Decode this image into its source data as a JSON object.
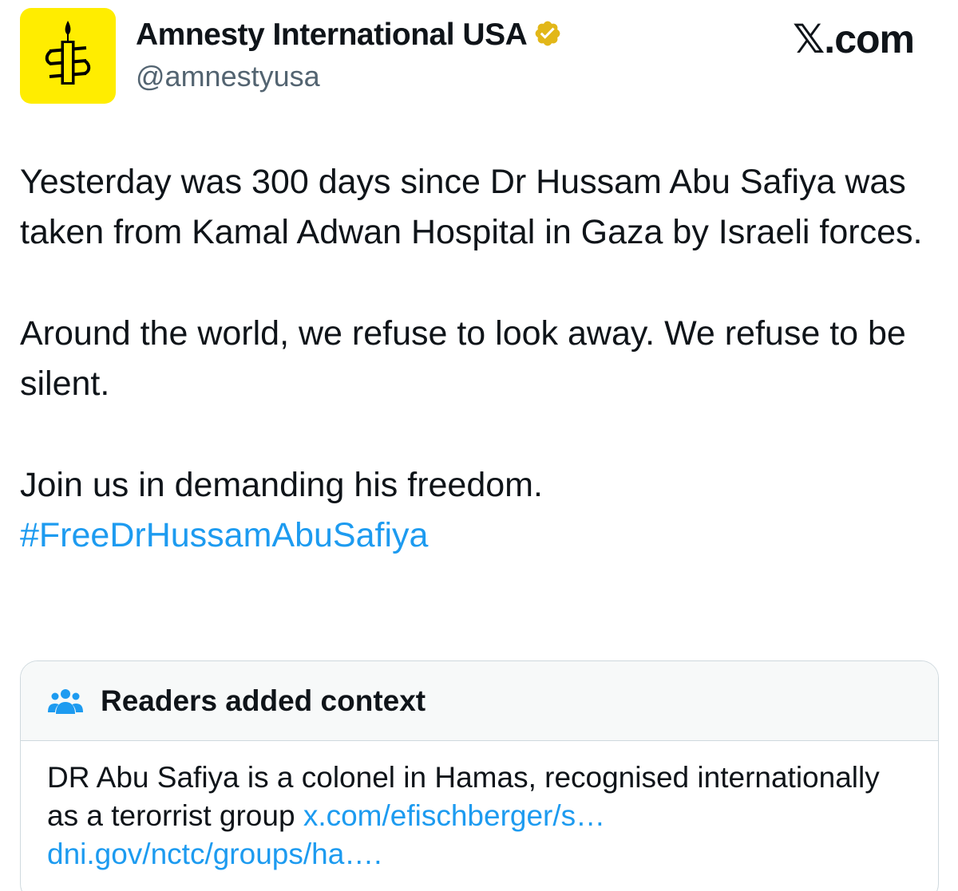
{
  "author": {
    "name": "Amnesty International USA",
    "handle": "@amnestyusa",
    "avatar_icon": "amnesty-candle-icon",
    "verified_icon": "verified-badge-icon",
    "avatar_color": "#ffed00",
    "verified_color": "#e2b719"
  },
  "brand": "𝕏.com",
  "tweet": {
    "paragraph1": "Yesterday was 300 days since Dr Hussam Abu Safiya was taken from Kamal Adwan Hospital in Gaza by Israeli forces.",
    "paragraph2": "Around the world, we refuse to look away. We refuse to be silent.",
    "paragraph3": "Join us in demanding his freedom.",
    "hashtag": "#FreeDrHussamAbuSafiya"
  },
  "community_note": {
    "title": "Readers added context",
    "icon": "people-group-icon",
    "text": "DR Abu Safiya is a colonel in Hamas, recognised internationally as a terorrist group ",
    "link1": "x.com/efischberger/s…",
    "link2": "dni.gov/nctc/groups/ha….",
    "accent_color": "#1d9bf0"
  }
}
